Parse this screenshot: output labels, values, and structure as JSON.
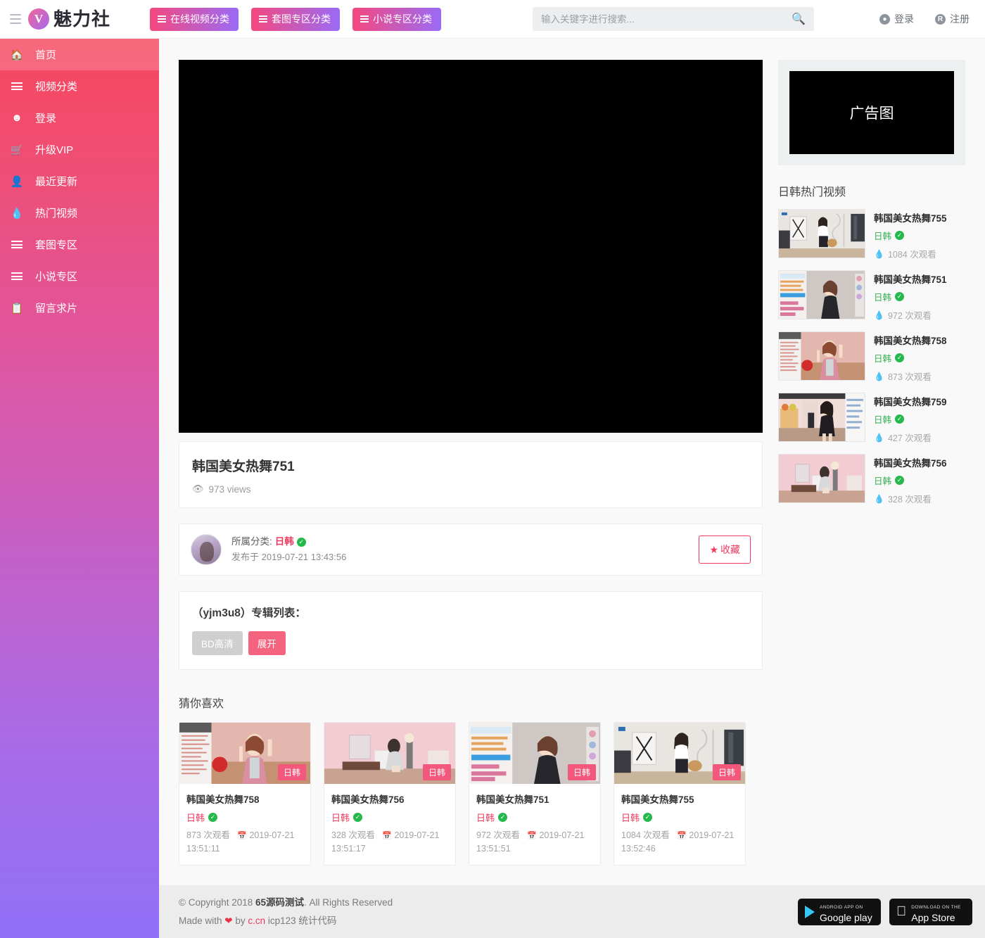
{
  "header": {
    "menu_icon": "hamburger-icon",
    "logo_letter": "V",
    "logo_text": "魅力社",
    "nav_buttons": [
      {
        "label": "在线视频分类"
      },
      {
        "label": "套图专区分类"
      },
      {
        "label": "小说专区分类"
      }
    ],
    "search": {
      "placeholder": "输入关键字进行搜索...",
      "value": "",
      "icon": "search-icon"
    },
    "auth": [
      {
        "label": "登录",
        "glyph": "ⓘ"
      },
      {
        "label": "注册",
        "glyph": "R"
      }
    ]
  },
  "sidebar": {
    "items": [
      {
        "label": "首页",
        "icon": "home-icon",
        "active": true
      },
      {
        "label": "视频分类",
        "icon": "list-icon",
        "active": false
      },
      {
        "label": "登录",
        "icon": "user-circle-icon",
        "active": false
      },
      {
        "label": "升级VIP",
        "icon": "cart-icon",
        "active": false
      },
      {
        "label": "最近更新",
        "icon": "person-icon",
        "active": false
      },
      {
        "label": "热门视频",
        "icon": "flame-icon",
        "active": false
      },
      {
        "label": "套图专区",
        "icon": "list-icon",
        "active": false
      },
      {
        "label": "小说专区",
        "icon": "list-icon",
        "active": false
      },
      {
        "label": "留言求片",
        "icon": "clipboard-icon",
        "active": false
      }
    ]
  },
  "main": {
    "video": {
      "title": "韩国美女热舞751",
      "views": "973 views",
      "views_icon": "eye-icon"
    },
    "meta": {
      "category_label": "所属分类:",
      "category": "日韩",
      "verified_icon": "verified-check-icon",
      "published_label": "发布于",
      "published_at": "2019-07-21 13:43:56",
      "favorite_button": "收藏",
      "favorite_icon": "star-icon"
    },
    "album": {
      "title": "（yjm3u8）专辑列表：",
      "quality_chip": "BD高清",
      "expand_chip": "展开"
    },
    "guess": {
      "heading": "猜你喜欢",
      "items": [
        {
          "title": "韩国美女热舞758",
          "badge": "日韩",
          "category": "日韩",
          "views": "873 次观看",
          "date": "2019-07-21 13:51:11"
        },
        {
          "title": "韩国美女热舞756",
          "badge": "日韩",
          "category": "日韩",
          "views": "328 次观看",
          "date": "2019-07-21 13:51:17"
        },
        {
          "title": "韩国美女热舞751",
          "badge": "日韩",
          "category": "日韩",
          "views": "972 次观看",
          "date": "2019-07-21 13:51:51"
        },
        {
          "title": "韩国美女热舞755",
          "badge": "日韩",
          "category": "日韩",
          "views": "1084 次观看",
          "date": "2019-07-21 13:52:46"
        }
      ]
    }
  },
  "right": {
    "ad_text": "广告图",
    "hot_heading": "日韩热门视频",
    "hot_items": [
      {
        "title": "韩国美女热舞755",
        "category": "日韩",
        "views": "1084 次观看"
      },
      {
        "title": "韩国美女热舞751",
        "category": "日韩",
        "views": "972 次观看"
      },
      {
        "title": "韩国美女热舞758",
        "category": "日韩",
        "views": "873 次观看"
      },
      {
        "title": "韩国美女热舞759",
        "category": "日韩",
        "views": "427 次观看"
      },
      {
        "title": "韩国美女热舞756",
        "category": "日韩",
        "views": "328 次观看"
      }
    ]
  },
  "footer": {
    "copyright_pre": "© Copyright 2018 ",
    "copyright_brand": "65源码测试",
    "copyright_post": ". All Rights Reserved",
    "made_pre": "Made with ",
    "made_by": " by ",
    "made_link": "c.cn",
    "made_post": " icp123 统计代码",
    "stores": [
      {
        "sub": "ANDROID APP ON",
        "main": "Google play"
      },
      {
        "sub": "Download on the",
        "main": "App Store"
      }
    ]
  },
  "colors": {
    "accent_pink": "#ef3a5d",
    "accent_purple": "#9070f7",
    "badge_pink": "#f4577c",
    "verified_green": "#25b84c"
  }
}
